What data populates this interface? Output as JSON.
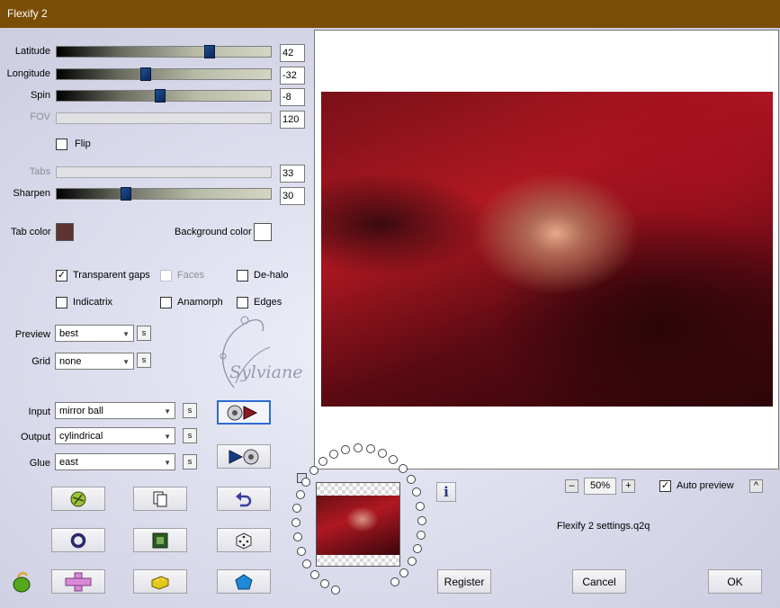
{
  "window": {
    "title": "Flexify 2"
  },
  "sliders": [
    {
      "label": "Latitude",
      "value": "42",
      "fraction": 0.72,
      "enabled": true
    },
    {
      "label": "Longitude",
      "value": "-32",
      "fraction": 0.41,
      "enabled": true
    },
    {
      "label": "Spin",
      "value": "-8",
      "fraction": 0.48,
      "enabled": true
    },
    {
      "label": "FOV",
      "value": "120",
      "fraction": null,
      "enabled": false
    },
    {
      "label": "Tabs",
      "value": "33",
      "fraction": null,
      "enabled": false
    },
    {
      "label": "Sharpen",
      "value": "30",
      "fraction": 0.31,
      "enabled": true
    }
  ],
  "flip": {
    "label": "Flip",
    "checked": false
  },
  "tab_color": {
    "label": "Tab color",
    "color": "#5c3432"
  },
  "background_color": {
    "label": "Background color",
    "color": "#ffffff"
  },
  "options": {
    "transparent_gaps": {
      "label": "Transparent gaps",
      "checked": true
    },
    "faces": {
      "label": "Faces",
      "checked": false,
      "enabled": false
    },
    "de_halo": {
      "label": "De-halo",
      "checked": false
    },
    "indicatrix": {
      "label": "Indicatrix",
      "checked": false
    },
    "anamorph": {
      "label": "Anamorph",
      "checked": false
    },
    "edges": {
      "label": "Edges",
      "checked": false
    }
  },
  "preview": {
    "label": "Preview",
    "value": "best"
  },
  "grid": {
    "label": "Grid",
    "value": "none"
  },
  "input": {
    "label": "Input",
    "value": "mirror ball"
  },
  "output": {
    "label": "Output",
    "value": "cylindrical"
  },
  "glue": {
    "label": "Glue",
    "value": "east"
  },
  "small_button_label": "s",
  "watermark": "Sylviane",
  "zoom": {
    "value": "50%",
    "minus": "–",
    "plus": "+"
  },
  "auto_preview": {
    "label": "Auto preview",
    "checked": true
  },
  "collapse_label": "^",
  "settings_file": "Flexify 2 settings.q2q",
  "buttons": {
    "register": "Register",
    "cancel": "Cancel",
    "ok": "OK"
  },
  "icons": {
    "swap_forward": "mirror-ball-to-output-icon",
    "swap_back": "output-to-mirror-ball-icon",
    "randomize_globe": "globe-random-icon",
    "copy": "copy-pages-icon",
    "undo": "undo-arrow-icon",
    "ring": "ring-icon",
    "square": "green-square-icon",
    "dice": "dice-icon",
    "cross": "pink-cross-icon",
    "brick": "yellow-brick-icon",
    "pentagon": "blue-pentagon-icon",
    "info": "info-icon",
    "logo": "flaming-pear-logo-icon"
  }
}
